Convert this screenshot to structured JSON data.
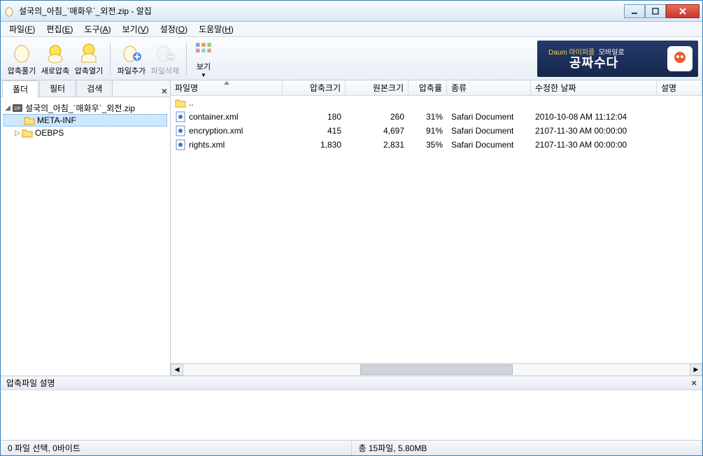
{
  "title": "설국의_아침_`매화우`_외전.zip - 알집",
  "menus": [
    "파일(F)",
    "편집(E)",
    "도구(A)",
    "보기(V)",
    "설정(O)",
    "도움말(H)"
  ],
  "toolbar": {
    "extract": "압축풀기",
    "newarc": "새로압축",
    "openarc": "압축열기",
    "addfile": "파일추가",
    "delfile": "파일삭제",
    "view": "보기"
  },
  "ad": {
    "line1": "Daum 마이피플",
    "line1b": "모바일로",
    "line2": "공짜수다"
  },
  "leftTabs": {
    "folder": "폴더",
    "filter": "필터",
    "search": "검색"
  },
  "tree": {
    "root": "설국의_아침_`매화우`_외전.zip",
    "items": [
      "META-INF",
      "OEBPS"
    ]
  },
  "columns": {
    "name": "파일명",
    "csize": "압축크기",
    "osize": "원본크기",
    "ratio": "압축률",
    "type": "종류",
    "date": "수정한 날짜",
    "desc": "설명"
  },
  "parentDir": "..",
  "files": [
    {
      "name": "container.xml",
      "csize": "180",
      "osize": "260",
      "ratio": "31%",
      "type": "Safari Document",
      "date": "2010-10-08 AM 11:12:04"
    },
    {
      "name": "encryption.xml",
      "csize": "415",
      "osize": "4,697",
      "ratio": "91%",
      "type": "Safari Document",
      "date": "2107-11-30 AM 00:00:00"
    },
    {
      "name": "rights.xml",
      "csize": "1,830",
      "osize": "2,831",
      "ratio": "35%",
      "type": "Safari Document",
      "date": "2107-11-30 AM 00:00:00"
    }
  ],
  "descPanel": "압축파일 설명",
  "status": {
    "left": "0 파일 선택,  0바이트",
    "right": "총 15파일,  5.80MB"
  }
}
